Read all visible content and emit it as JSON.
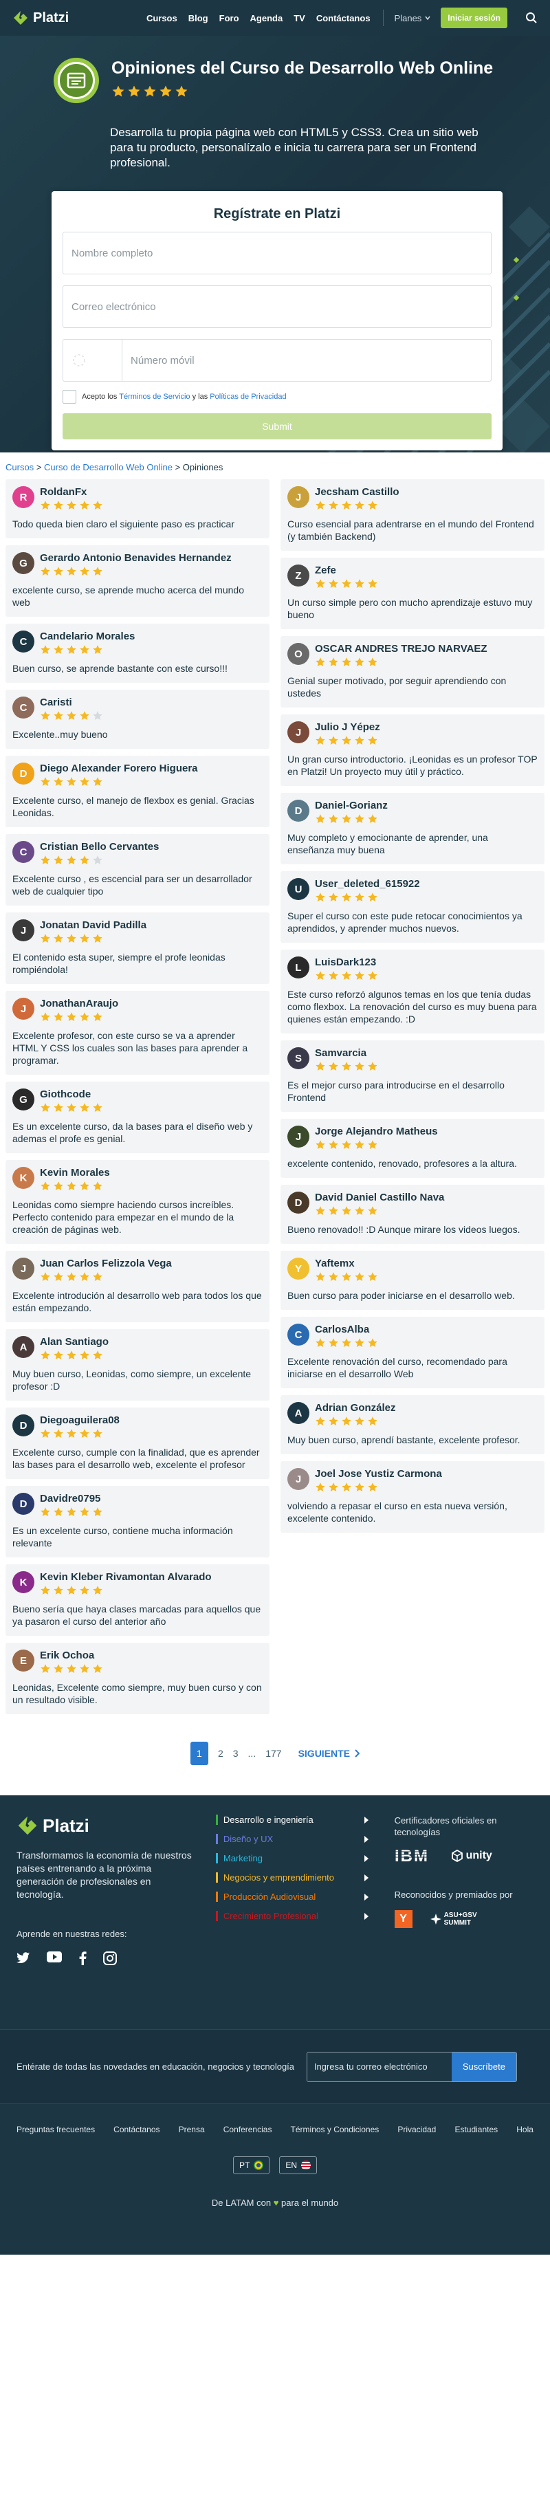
{
  "header": {
    "brand": "Platzi",
    "nav": [
      "Cursos",
      "Blog",
      "Foro",
      "Agenda",
      "TV",
      "Contáctanos"
    ],
    "plans": "Planes",
    "login": "Iniciar sesión"
  },
  "hero": {
    "title": "Opiniones del Curso de Desarrollo Web Online",
    "rating": 5,
    "description": "Desarrolla tu propia página web con HTML5 y CSS3. Crea un sitio web para tu producto, personalízalo e inicia tu carrera para ser un Frontend profesional.",
    "form": {
      "title": "Regístrate en Platzi",
      "name_placeholder": "Nombre completo",
      "email_placeholder": "Correo electrónico",
      "phone_placeholder": "Número móvil",
      "terms_prefix": "Acepto los ",
      "terms_link": "Términos de Servicio",
      "terms_mid": " y las ",
      "privacy_link": "Políticas de Privacidad",
      "submit": "Submit"
    }
  },
  "breadcrumb": {
    "cursos": "Cursos",
    "sep": ">",
    "course": "Curso de Desarrollo Web Online",
    "current": "Opiniones"
  },
  "reviews_left": [
    {
      "name": "RoldanFx",
      "stars": 5,
      "color": "#e0408e",
      "text": "Todo queda bien claro el siguiente paso es practicar"
    },
    {
      "name": "Gerardo Antonio Benavides Hernandez",
      "stars": 5,
      "color": "#5a4a3f",
      "text": "excelente curso, se aprende mucho acerca del mundo web"
    },
    {
      "name": "Candelario Morales",
      "stars": 5,
      "color": "#1c3643",
      "text": "Buen curso, se aprende bastante con este curso!!!"
    },
    {
      "name": "Caristi",
      "stars": 4,
      "color": "#8e6b5a",
      "text": "Excelente..muy bueno"
    },
    {
      "name": "Diego Alexander Forero Higuera",
      "stars": 5,
      "color": "#f0a21a",
      "text": "Excelente curso, el manejo de flexbox es genial. Gracias Leonidas."
    },
    {
      "name": "Cristian Bello Cervantes",
      "stars": 4,
      "color": "#6b4a8a",
      "text": "Excelente curso , es escencial para ser un desarrollador web de cualquier tipo"
    },
    {
      "name": "Jonatan David Padilla",
      "stars": 5,
      "color": "#3a3a3a",
      "text": "El contenido esta super, siempre el profe leonidas rompiéndola!"
    },
    {
      "name": "JonathanAraujo",
      "stars": 5,
      "color": "#d06a3a",
      "text": "Excelente profesor, con este curso se va a aprender HTML Y CSS los cuales son las bases para aprender a programar."
    },
    {
      "name": "Giothcode",
      "stars": 5,
      "color": "#2a2a2a",
      "text": "Es un excelente curso, da la bases para el diseño web y ademas el profe es genial."
    },
    {
      "name": "Kevin Morales",
      "stars": 5,
      "color": "#c97a4a",
      "text": "Leonidas como siempre haciendo cursos increíbles. Perfecto contenido para empezar en el mundo de la creación de páginas web."
    },
    {
      "name": "Juan Carlos Felizzola Vega",
      "stars": 5,
      "color": "#7a6a5a",
      "text": "Excelente introdución al desarrollo web para todos los que están empezando."
    },
    {
      "name": "Alan Santiago",
      "stars": 5,
      "color": "#4a3a3a",
      "text": "Muy buen curso, Leonidas, como siempre, un excelente profesor :D"
    },
    {
      "name": "Diegoaguilera08",
      "stars": 5,
      "color": "#1c3643",
      "text": "Excelente curso, cumple con la finalidad, que es aprender las bases para el desarrollo web, excelente el profesor"
    },
    {
      "name": "Davidre0795",
      "stars": 5,
      "color": "#2a3a6a",
      "text": "Es un excelente curso, contiene mucha información relevante"
    },
    {
      "name": "Kevin Kleber Rivamontan Alvarado",
      "stars": 5,
      "color": "#8a2a8a",
      "text": "Bueno sería que haya clases marcadas para aquellos que ya pasaron el curso del anterior año"
    },
    {
      "name": "Erik Ochoa",
      "stars": 5,
      "color": "#9a6a4a",
      "text": "Leonidas, Excelente como siempre, muy buen curso y con un resultado visible."
    }
  ],
  "reviews_right": [
    {
      "name": "Jecsham Castillo",
      "stars": 5,
      "color": "#c9a03a",
      "text": "Curso esencial para adentrarse en el mundo del Frontend (y también Backend)"
    },
    {
      "name": "Zefe",
      "stars": 5,
      "color": "#4a4a4a",
      "text": "Un curso simple pero con mucho aprendizaje estuvo muy bueno"
    },
    {
      "name": "OSCAR ANDRES TREJO NARVAEZ",
      "stars": 5,
      "color": "#6a6a6a",
      "text": "Genial super motivado, por seguir aprendiendo con ustedes"
    },
    {
      "name": "Julio J Yépez",
      "stars": 5,
      "color": "#7a4a3a",
      "text": "Un gran curso introductorio. ¡Leonidas es un profesor TOP en Platzi! Un proyecto muy útil y práctico."
    },
    {
      "name": "Daniel-Gorianz",
      "stars": 5,
      "color": "#5a7a8a",
      "text": "Muy completo y emocionante de aprender, una enseñanza muy buena"
    },
    {
      "name": "User_deleted_615922",
      "stars": 5,
      "color": "#1c3643",
      "text": "Super el curso con este pude retocar conocimientos ya aprendidos, y aprender muchos nuevos."
    },
    {
      "name": "LuisDark123",
      "stars": 5,
      "color": "#2a2a2a",
      "text": "Este curso reforzó algunos temas en los que tenía dudas como flexbox. La renovación del curso es muy buena para quienes están empezando. :D"
    },
    {
      "name": "Samvarcia",
      "stars": 5,
      "color": "#3a3a4a",
      "text": "Es el mejor curso para introducirse en el desarrollo Frontend"
    },
    {
      "name": "Jorge Alejandro Matheus",
      "stars": 5,
      "color": "#3a4a2a",
      "text": "excelente contenido, renovado, profesores a la altura."
    },
    {
      "name": "David Daniel Castillo Nava",
      "stars": 5,
      "color": "#4a3a2a",
      "text": "Bueno renovado!! :D Aunque mirare los videos luegos."
    },
    {
      "name": "Yaftemx",
      "stars": 5,
      "color": "#f0c030",
      "text": "Buen curso para poder iniciarse en el desarrollo web."
    },
    {
      "name": "CarlosAlba",
      "stars": 5,
      "color": "#2a6ab0",
      "text": "Excelente renovación del curso, recomendado para iniciarse en el desarrollo Web"
    },
    {
      "name": "Adrian González",
      "stars": 5,
      "color": "#1c3643",
      "text": "Muy buen curso, aprendí bastante, excelente profesor."
    },
    {
      "name": "Joel Jose Yustiz Carmona",
      "stars": 5,
      "color": "#9a8a8a",
      "text": "volviendo a repasar el curso en esta nueva versión, excelente contenido."
    }
  ],
  "pagination": {
    "pages": [
      "1",
      "2",
      "3",
      "...",
      "177"
    ],
    "active": "1",
    "next": "SIGUIENTE"
  },
  "footer": {
    "brand": "Platzi",
    "tagline": "Transformamos la economía de nuestros países entrenando a la próxima generación de profesionales en tecnología.",
    "learn_label": "Aprende en nuestras redes:",
    "categories": [
      {
        "label": "Desarrollo e ingeniería",
        "color": "#33b13a"
      },
      {
        "label": "Diseño y UX",
        "color": "#6b7ae0"
      },
      {
        "label": "Marketing",
        "color": "#29b8db"
      },
      {
        "label": "Negocios y emprendimiento",
        "color": "#f6b82a"
      },
      {
        "label": "Producción Audiovisual",
        "color": "#fa7800"
      },
      {
        "label": "Crecimiento Profesional",
        "color": "#cb161d"
      }
    ],
    "certs_title": "Certificadores oficiales en tecnologías",
    "cert_logos": [
      "IBM",
      "unity"
    ],
    "awards_title": "Reconocidos y premiados por",
    "award_logos": [
      "Y",
      "ASU+GSV SUMMIT"
    ],
    "newsletter_text": "Entérate de todas las novedades en educación, negocios y tecnología",
    "newsletter_placeholder": "Ingresa tu correo electrónico",
    "newsletter_button": "Suscríbete",
    "links": [
      "Preguntas frecuentes",
      "Contáctanos",
      "Prensa",
      "Conferencias",
      "Términos y Condiciones",
      "Privacidad",
      "Estudiantes",
      "Hola"
    ],
    "langs": [
      "PT",
      "EN"
    ],
    "made_prefix": "De LATAM con ",
    "made_suffix": " para el mundo"
  },
  "colors": {
    "brand_green": "#98ca3f",
    "navy": "#1c3643",
    "link_blue": "#2a7ad0",
    "star_yellow": "#f5b820"
  }
}
